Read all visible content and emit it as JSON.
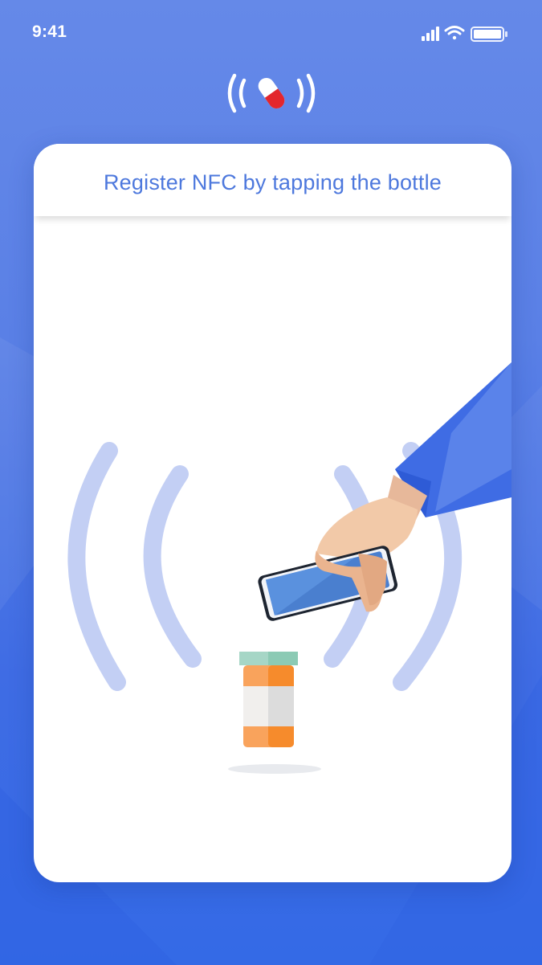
{
  "status_bar": {
    "time": "9:41",
    "signal_icon": "cellular-signal-icon",
    "wifi_icon": "wifi-icon",
    "battery_icon": "battery-icon"
  },
  "app_logo": {
    "icon": "nfc-pill-icon"
  },
  "card": {
    "title": "Register NFC by tapping the bottle",
    "illustration": {
      "icons": [
        "nfc-waves-icon",
        "hand-holding-phone-icon",
        "pill-bottle-icon"
      ]
    }
  },
  "colors": {
    "background": "#5a80e6",
    "title": "#4d78dd",
    "waves": "#c3cff4",
    "sleeve": "#3f6ce4",
    "bottle_orange": "#f68b2c",
    "bottle_cap": "#a6d6c6"
  }
}
